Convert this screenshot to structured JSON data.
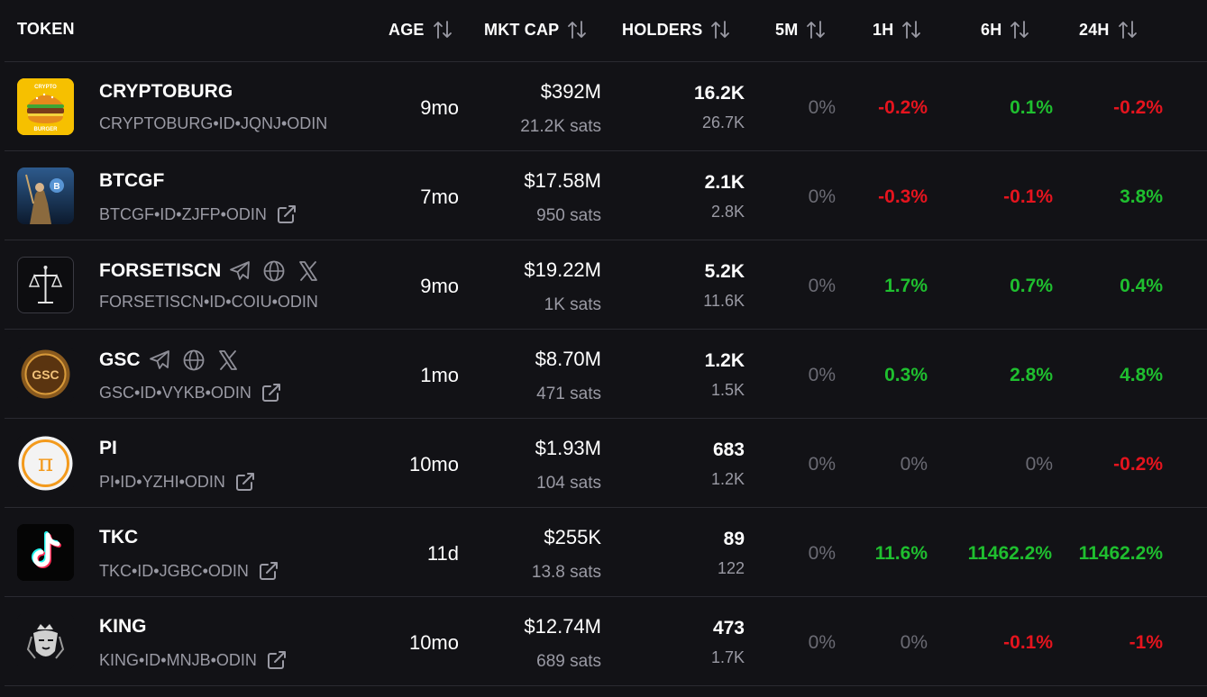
{
  "header": {
    "token": "TOKEN",
    "age": "AGE",
    "mkt_cap": "MKT CAP",
    "holders": "HOLDERS",
    "m5": "5M",
    "h1": "1H",
    "h6": "6H",
    "h24": "24H"
  },
  "colors": {
    "positive": "#1fbf2f",
    "negative": "#e5141e",
    "neutral": "#6b6b74",
    "background": "#121216"
  },
  "rows": [
    {
      "name": "CRYPTOBURG",
      "id": "CRYPTOBURG•ID•JQNJ•ODIN",
      "age": "9mo",
      "mkt_cap": "$392M",
      "sats": "21.2K sats",
      "holders": "16.2K",
      "holders2": "26.7K",
      "m5": "0%",
      "h1": "-0.2%",
      "h6": "0.1%",
      "h24": "-0.2%",
      "logo_text": "CRYPTO BURGER"
    },
    {
      "name": "BTCGF",
      "id": "BTCGF•ID•ZJFP•ODIN",
      "age": "7mo",
      "mkt_cap": "$17.58M",
      "sats": "950 sats",
      "holders": "2.1K",
      "holders2": "2.8K",
      "m5": "0%",
      "h1": "-0.3%",
      "h6": "-0.1%",
      "h24": "3.8%"
    },
    {
      "name": "FORSETISCN",
      "id": "FORSETISCN•ID•COIU•ODIN",
      "age": "9mo",
      "mkt_cap": "$19.22M",
      "sats": "1K sats",
      "holders": "5.2K",
      "holders2": "11.6K",
      "m5": "0%",
      "h1": "1.7%",
      "h6": "0.7%",
      "h24": "0.4%"
    },
    {
      "name": "GSC",
      "id": "GSC•ID•VYKB•ODIN",
      "age": "1mo",
      "mkt_cap": "$8.70M",
      "sats": "471 sats",
      "holders": "1.2K",
      "holders2": "1.5K",
      "m5": "0%",
      "h1": "0.3%",
      "h6": "2.8%",
      "h24": "4.8%",
      "logo_text": "GSC"
    },
    {
      "name": "PI",
      "id": "PI•ID•YZHI•ODIN",
      "age": "10mo",
      "mkt_cap": "$1.93M",
      "sats": "104 sats",
      "holders": "683",
      "holders2": "1.2K",
      "m5": "0%",
      "h1": "0%",
      "h6": "0%",
      "h24": "-0.2%",
      "logo_text": "π"
    },
    {
      "name": "TKC",
      "id": "TKC•ID•JGBC•ODIN",
      "age": "11d",
      "mkt_cap": "$255K",
      "sats": "13.8 sats",
      "holders": "89",
      "holders2": "122",
      "m5": "0%",
      "h1": "11.6%",
      "h6": "11462.2%",
      "h24": "11462.2%"
    },
    {
      "name": "KING",
      "id": "KING•ID•MNJB•ODIN",
      "age": "10mo",
      "mkt_cap": "$12.74M",
      "sats": "689 sats",
      "holders": "473",
      "holders2": "1.7K",
      "m5": "0%",
      "h1": "0%",
      "h6": "-0.1%",
      "h24": "-1%"
    }
  ]
}
